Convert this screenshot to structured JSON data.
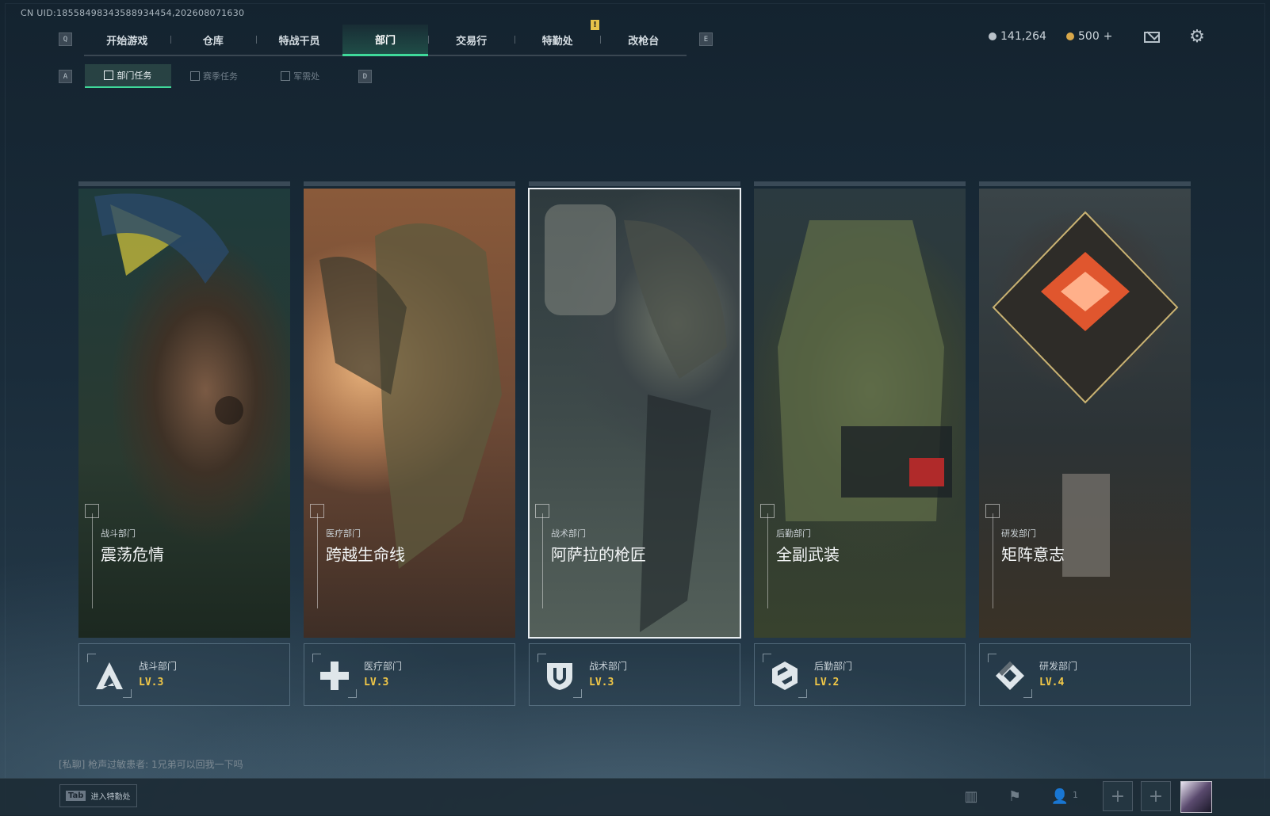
{
  "uid": "CN UID:18558498343588934454,202608071630",
  "nav": {
    "key_left": "Q",
    "key_right": "E",
    "tabs": [
      "开始游戏",
      "仓库",
      "特战干员",
      "部门",
      "交易行",
      "特勤处",
      "改枪台"
    ],
    "active_index": 3,
    "alert_badge": "!"
  },
  "subnav": {
    "key_left": "A",
    "key_right": "D",
    "tabs": [
      "部门任务",
      "赛季任务",
      "军需处"
    ],
    "active_index": 0
  },
  "currency": {
    "silver": "141,264",
    "gold": "500",
    "gold_add": "+",
    "silver_color": "#b9c2c9",
    "gold_color": "#d9a84a"
  },
  "departments": [
    {
      "category": "战斗部门",
      "title": "震荡危情",
      "level": "LV.3",
      "emblem": "combat-emblem-icon",
      "selected": false
    },
    {
      "category": "医疗部门",
      "title": "跨越生命线",
      "level": "LV.3",
      "emblem": "medical-emblem-icon",
      "selected": false
    },
    {
      "category": "战术部门",
      "title": "阿萨拉的枪匠",
      "level": "LV.3",
      "emblem": "tactical-emblem-icon",
      "selected": true
    },
    {
      "category": "后勤部门",
      "title": "全副武装",
      "level": "LV.2",
      "emblem": "logistics-emblem-icon",
      "selected": false
    },
    {
      "category": "研发部门",
      "title": "矩阵意志",
      "level": "LV.4",
      "emblem": "research-emblem-icon",
      "selected": false
    }
  ],
  "chat": {
    "message": "[私聊] 枪声过敏患者: 1兄弟可以回我一下吗"
  },
  "bottom": {
    "tab_key": "Tab",
    "tab_label": "进入特勤处",
    "friend_count": "1",
    "slot_symbol": "+"
  },
  "colors": {
    "accent": "#3fd99a",
    "level": "#f2c847"
  }
}
